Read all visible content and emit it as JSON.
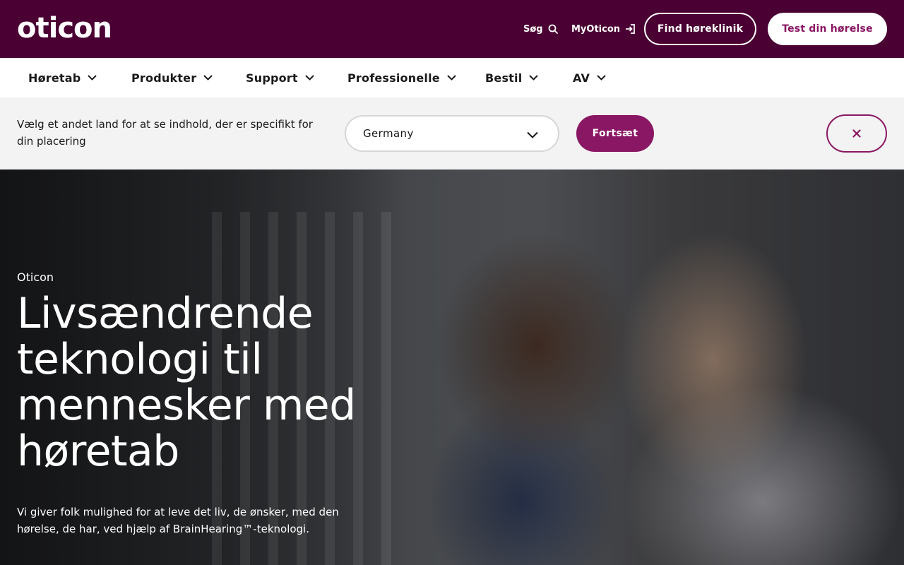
{
  "header": {
    "logo_text": "oticon",
    "search_label": "Søg",
    "myoticon_label": "MyOticon",
    "find_clinic_label": "Find høreklinik",
    "test_hearing_label": "Test din hørelse"
  },
  "nav": {
    "items": [
      {
        "label": "Høretab"
      },
      {
        "label": "Produkter"
      },
      {
        "label": "Support"
      },
      {
        "label": "Professionelle"
      },
      {
        "label": "Bestil"
      },
      {
        "label": "AV"
      }
    ]
  },
  "country_bar": {
    "message": "Vælg et andet land for at se indhold, der er specifikt for din placering",
    "selected_country": "Germany",
    "continue_label": "Fortsæt"
  },
  "hero": {
    "eyebrow": "Oticon",
    "title": "Livsændrende teknologi til mennesker med høretab",
    "text": "Vi giver folk mulighed for at leve det liv, de ønsker, med den hørelse, de har, ved hjælp af BrainHearing™-teknologi."
  },
  "colors": {
    "header_bg": "#4a0033",
    "accent": "#8a1763",
    "country_bar_bg": "#f3f3f3"
  },
  "icons": {
    "search": "search-icon",
    "login": "login-icon",
    "chevron": "chevron-down-icon",
    "close": "close-icon"
  }
}
